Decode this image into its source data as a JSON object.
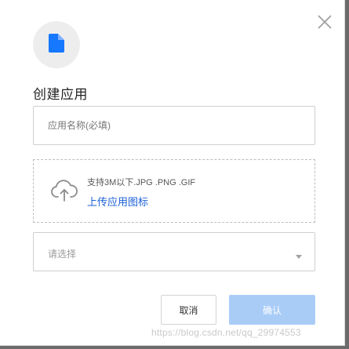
{
  "dialog": {
    "title": "创建应用",
    "close_icon": "close-icon",
    "app_icon": "file-icon",
    "app_icon_color": "#1677ff",
    "name_field": {
      "value": "",
      "placeholder": "应用名称(必填)"
    },
    "upload": {
      "icon": "cloud-upload-icon",
      "hint": "支持3M以下.JPG .PNG .GIF",
      "link_label": "上传应用图标",
      "link_color": "#1a5fd6"
    },
    "select": {
      "placeholder": "请选择",
      "arrow_icon": "caret-down-icon"
    },
    "buttons": {
      "cancel_label": "取消",
      "confirm_label": "确认",
      "confirm_color": "#a9ccf7",
      "confirm_disabled": true
    }
  },
  "watermark": "https://blog.csdn.net/qq_29974553"
}
